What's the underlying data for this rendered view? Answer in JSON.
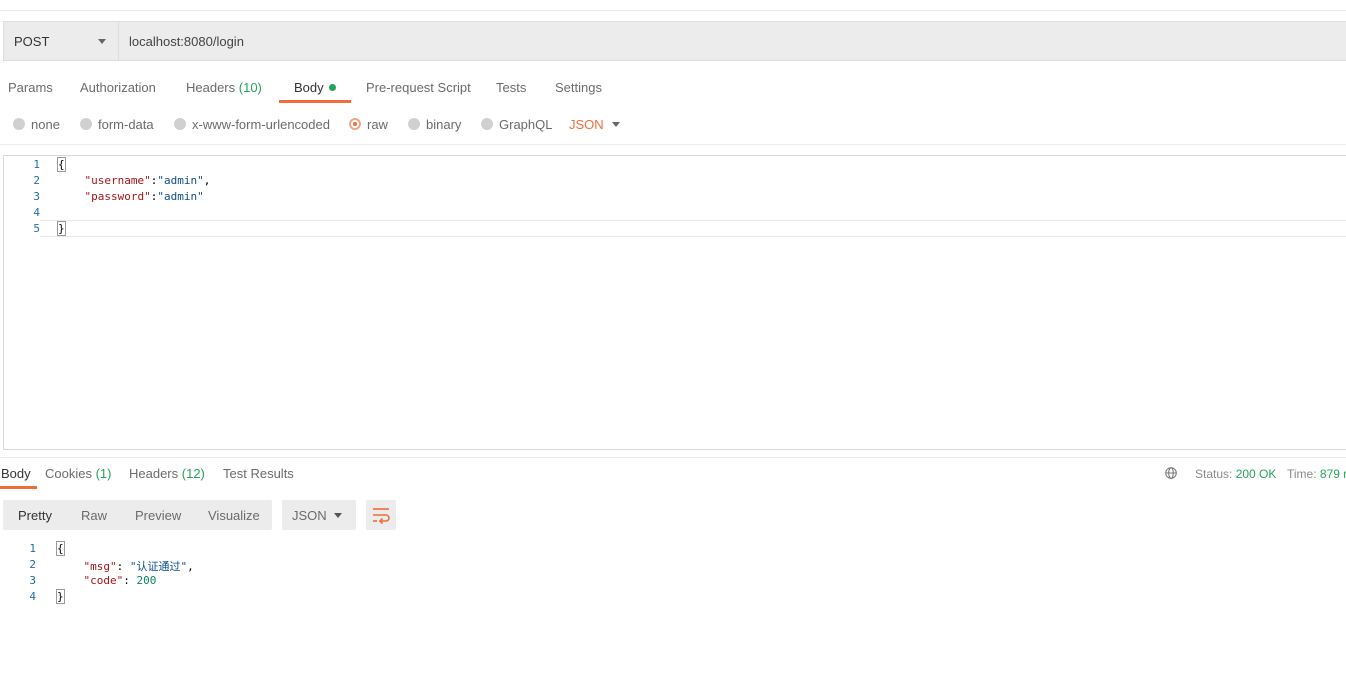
{
  "request": {
    "method": "POST",
    "url": "localhost:8080/login"
  },
  "request_tabs": [
    {
      "label": "Params"
    },
    {
      "label": "Authorization"
    },
    {
      "label": "Headers",
      "count": "(10)"
    },
    {
      "label": "Body",
      "active": true
    },
    {
      "label": "Pre-request Script"
    },
    {
      "label": "Tests"
    },
    {
      "label": "Settings"
    }
  ],
  "body_types": [
    {
      "label": "none"
    },
    {
      "label": "form-data"
    },
    {
      "label": "x-www-form-urlencoded"
    },
    {
      "label": "raw",
      "selected": true
    },
    {
      "label": "binary"
    },
    {
      "label": "GraphQL"
    }
  ],
  "body_format": "JSON",
  "request_body_lines": [
    {
      "n": "1",
      "text": "{"
    },
    {
      "n": "2",
      "key": "\"username\"",
      "sep": ":",
      "val": "\"admin\"",
      "tail": ","
    },
    {
      "n": "3",
      "key": "\"password\"",
      "sep": ":",
      "val": "\"admin\"",
      "tail": ""
    },
    {
      "n": "4",
      "text": ""
    },
    {
      "n": "5",
      "text": "}"
    }
  ],
  "response_tabs": [
    {
      "label": "Body",
      "active": true
    },
    {
      "label": "Cookies",
      "count": "(1)"
    },
    {
      "label": "Headers",
      "count": "(12)"
    },
    {
      "label": "Test Results"
    }
  ],
  "response_status": {
    "status_label": "Status:",
    "status_value": "200 OK",
    "time_label": "Time:",
    "time_value": "879 r"
  },
  "response_views": [
    "Pretty",
    "Raw",
    "Preview",
    "Visualize"
  ],
  "response_format": "JSON",
  "response_body_lines": [
    {
      "n": "1",
      "text": "{"
    },
    {
      "n": "2",
      "key": "\"msg\"",
      "sep": ": ",
      "val": "\"认证通过\"",
      "tail": ","
    },
    {
      "n": "3",
      "key": "\"code\"",
      "sep": ": ",
      "num": "200",
      "tail": ""
    },
    {
      "n": "4",
      "text": "}"
    }
  ],
  "colors": {
    "accent": "#f26b3a",
    "success": "#26a35a"
  }
}
